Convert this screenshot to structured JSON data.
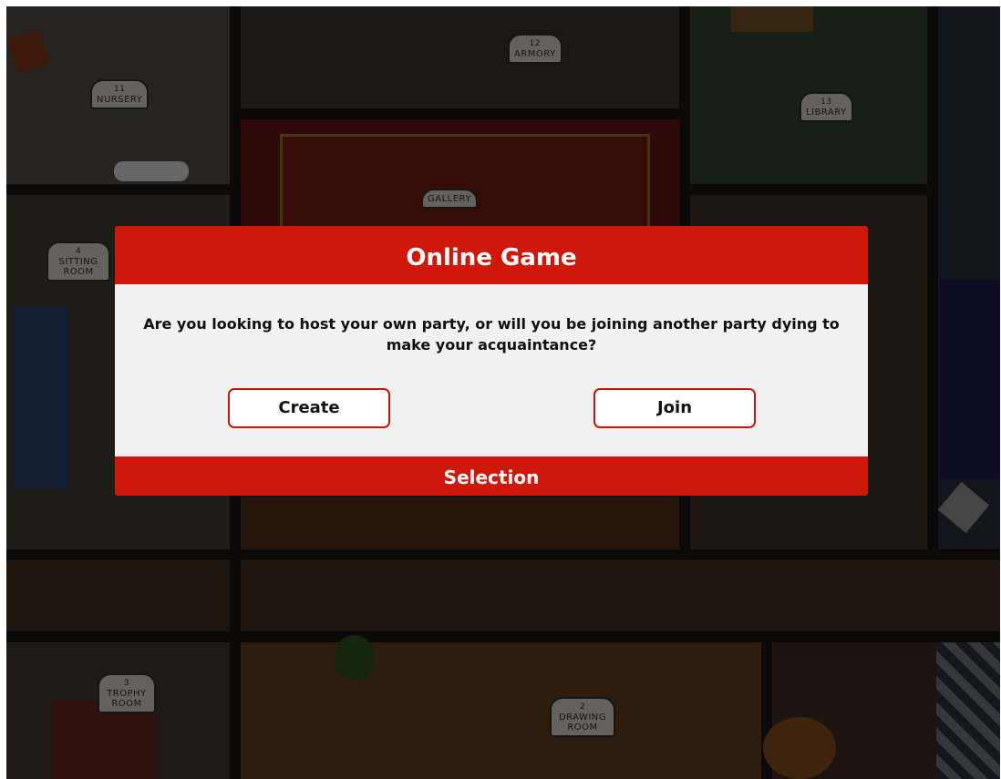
{
  "map": {
    "rooms": [
      {
        "number": "11",
        "name": "NURSERY"
      },
      {
        "number": "12",
        "name": "ARMORY"
      },
      {
        "number": "13",
        "name": "LIBRARY"
      },
      {
        "number": "",
        "name": "GALLERY"
      },
      {
        "number": "4",
        "name": "SITTING ROOM"
      },
      {
        "number": "3",
        "name": "TROPHY ROOM"
      },
      {
        "number": "2",
        "name": "DRAWING ROOM"
      }
    ]
  },
  "dialog": {
    "title": "Online Game",
    "message": "Are you looking to host your own party, or will you be joining another party dying to make your acquaintance?",
    "create_label": "Create",
    "join_label": "Join",
    "footer": "Selection"
  },
  "colors": {
    "accent": "#d0180a",
    "dialog_bg": "#f1f1f1"
  }
}
